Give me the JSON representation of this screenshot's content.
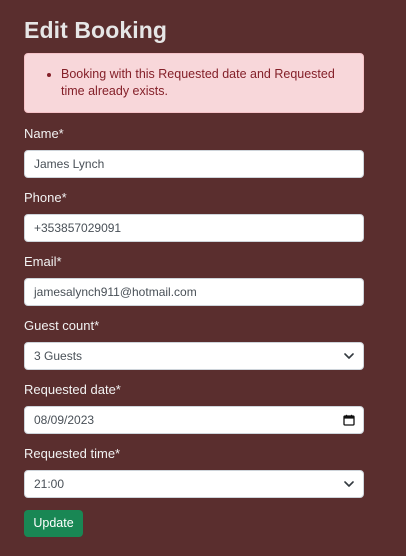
{
  "page": {
    "title": "Edit Booking"
  },
  "alert": {
    "message": "Booking with this Requested date and Requested time already exists."
  },
  "form": {
    "name": {
      "label": "Name*",
      "value": "James Lynch"
    },
    "phone": {
      "label": "Phone*",
      "value": "+353857029091"
    },
    "email": {
      "label": "Email*",
      "value": "jamesalynch911@hotmail.com"
    },
    "guest_count": {
      "label": "Guest count*",
      "value": "3 Guests"
    },
    "requested_date": {
      "label": "Requested date*",
      "value": "08/09/2023"
    },
    "requested_time": {
      "label": "Requested time*",
      "value": "21:00"
    },
    "submit_label": "Update"
  },
  "colors": {
    "background": "#5a2e2e",
    "alert_bg": "#f8d7da",
    "alert_text": "#842029",
    "button": "#198754"
  },
  "icons": {
    "select": "chevron-down-icon",
    "date": "calendar-icon"
  }
}
